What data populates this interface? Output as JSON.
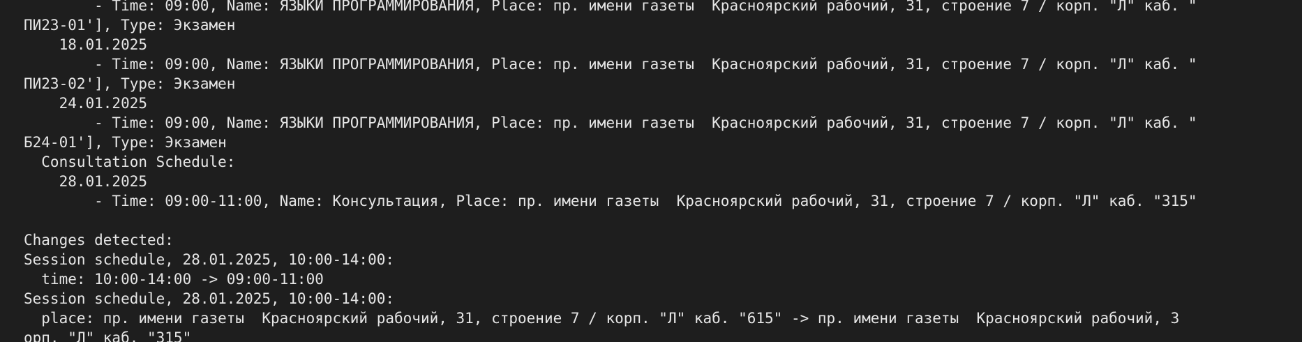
{
  "terminal": {
    "lines": [
      "        - Time: 09:00, Name: ЯЗЫКИ ПРОГРАММИРОВАНИЯ, Place: пр. имени газеты  Красноярский рабочий, 31, строение 7 / корп. \"Л\" каб. \"",
      "ПИ23-01'], Type: Экзамен",
      "    18.01.2025",
      "        - Time: 09:00, Name: ЯЗЫКИ ПРОГРАММИРОВАНИЯ, Place: пр. имени газеты  Красноярский рабочий, 31, строение 7 / корп. \"Л\" каб. \"",
      "ПИ23-02'], Type: Экзамен",
      "    24.01.2025",
      "        - Time: 09:00, Name: ЯЗЫКИ ПРОГРАММИРОВАНИЯ, Place: пр. имени газеты  Красноярский рабочий, 31, строение 7 / корп. \"Л\" каб. \"",
      "Б24-01'], Type: Экзамен",
      "  Consultation Schedule:",
      "    28.01.2025",
      "        - Time: 09:00-11:00, Name: Консультация, Place: пр. имени газеты  Красноярский рабочий, 31, строение 7 / корп. \"Л\" каб. \"315\"",
      "",
      "Changes detected:",
      "Session schedule, 28.01.2025, 10:00-14:00:",
      "  time: 10:00-14:00 -> 09:00-11:00",
      "Session schedule, 28.01.2025, 10:00-14:00:",
      "  place: пр. имени газеты  Красноярский рабочий, 31, строение 7 / корп. \"Л\" каб. \"615\" -> пр. имени газеты  Красноярский рабочий, 3",
      "орп. \"Л\" каб. \"315\""
    ]
  }
}
